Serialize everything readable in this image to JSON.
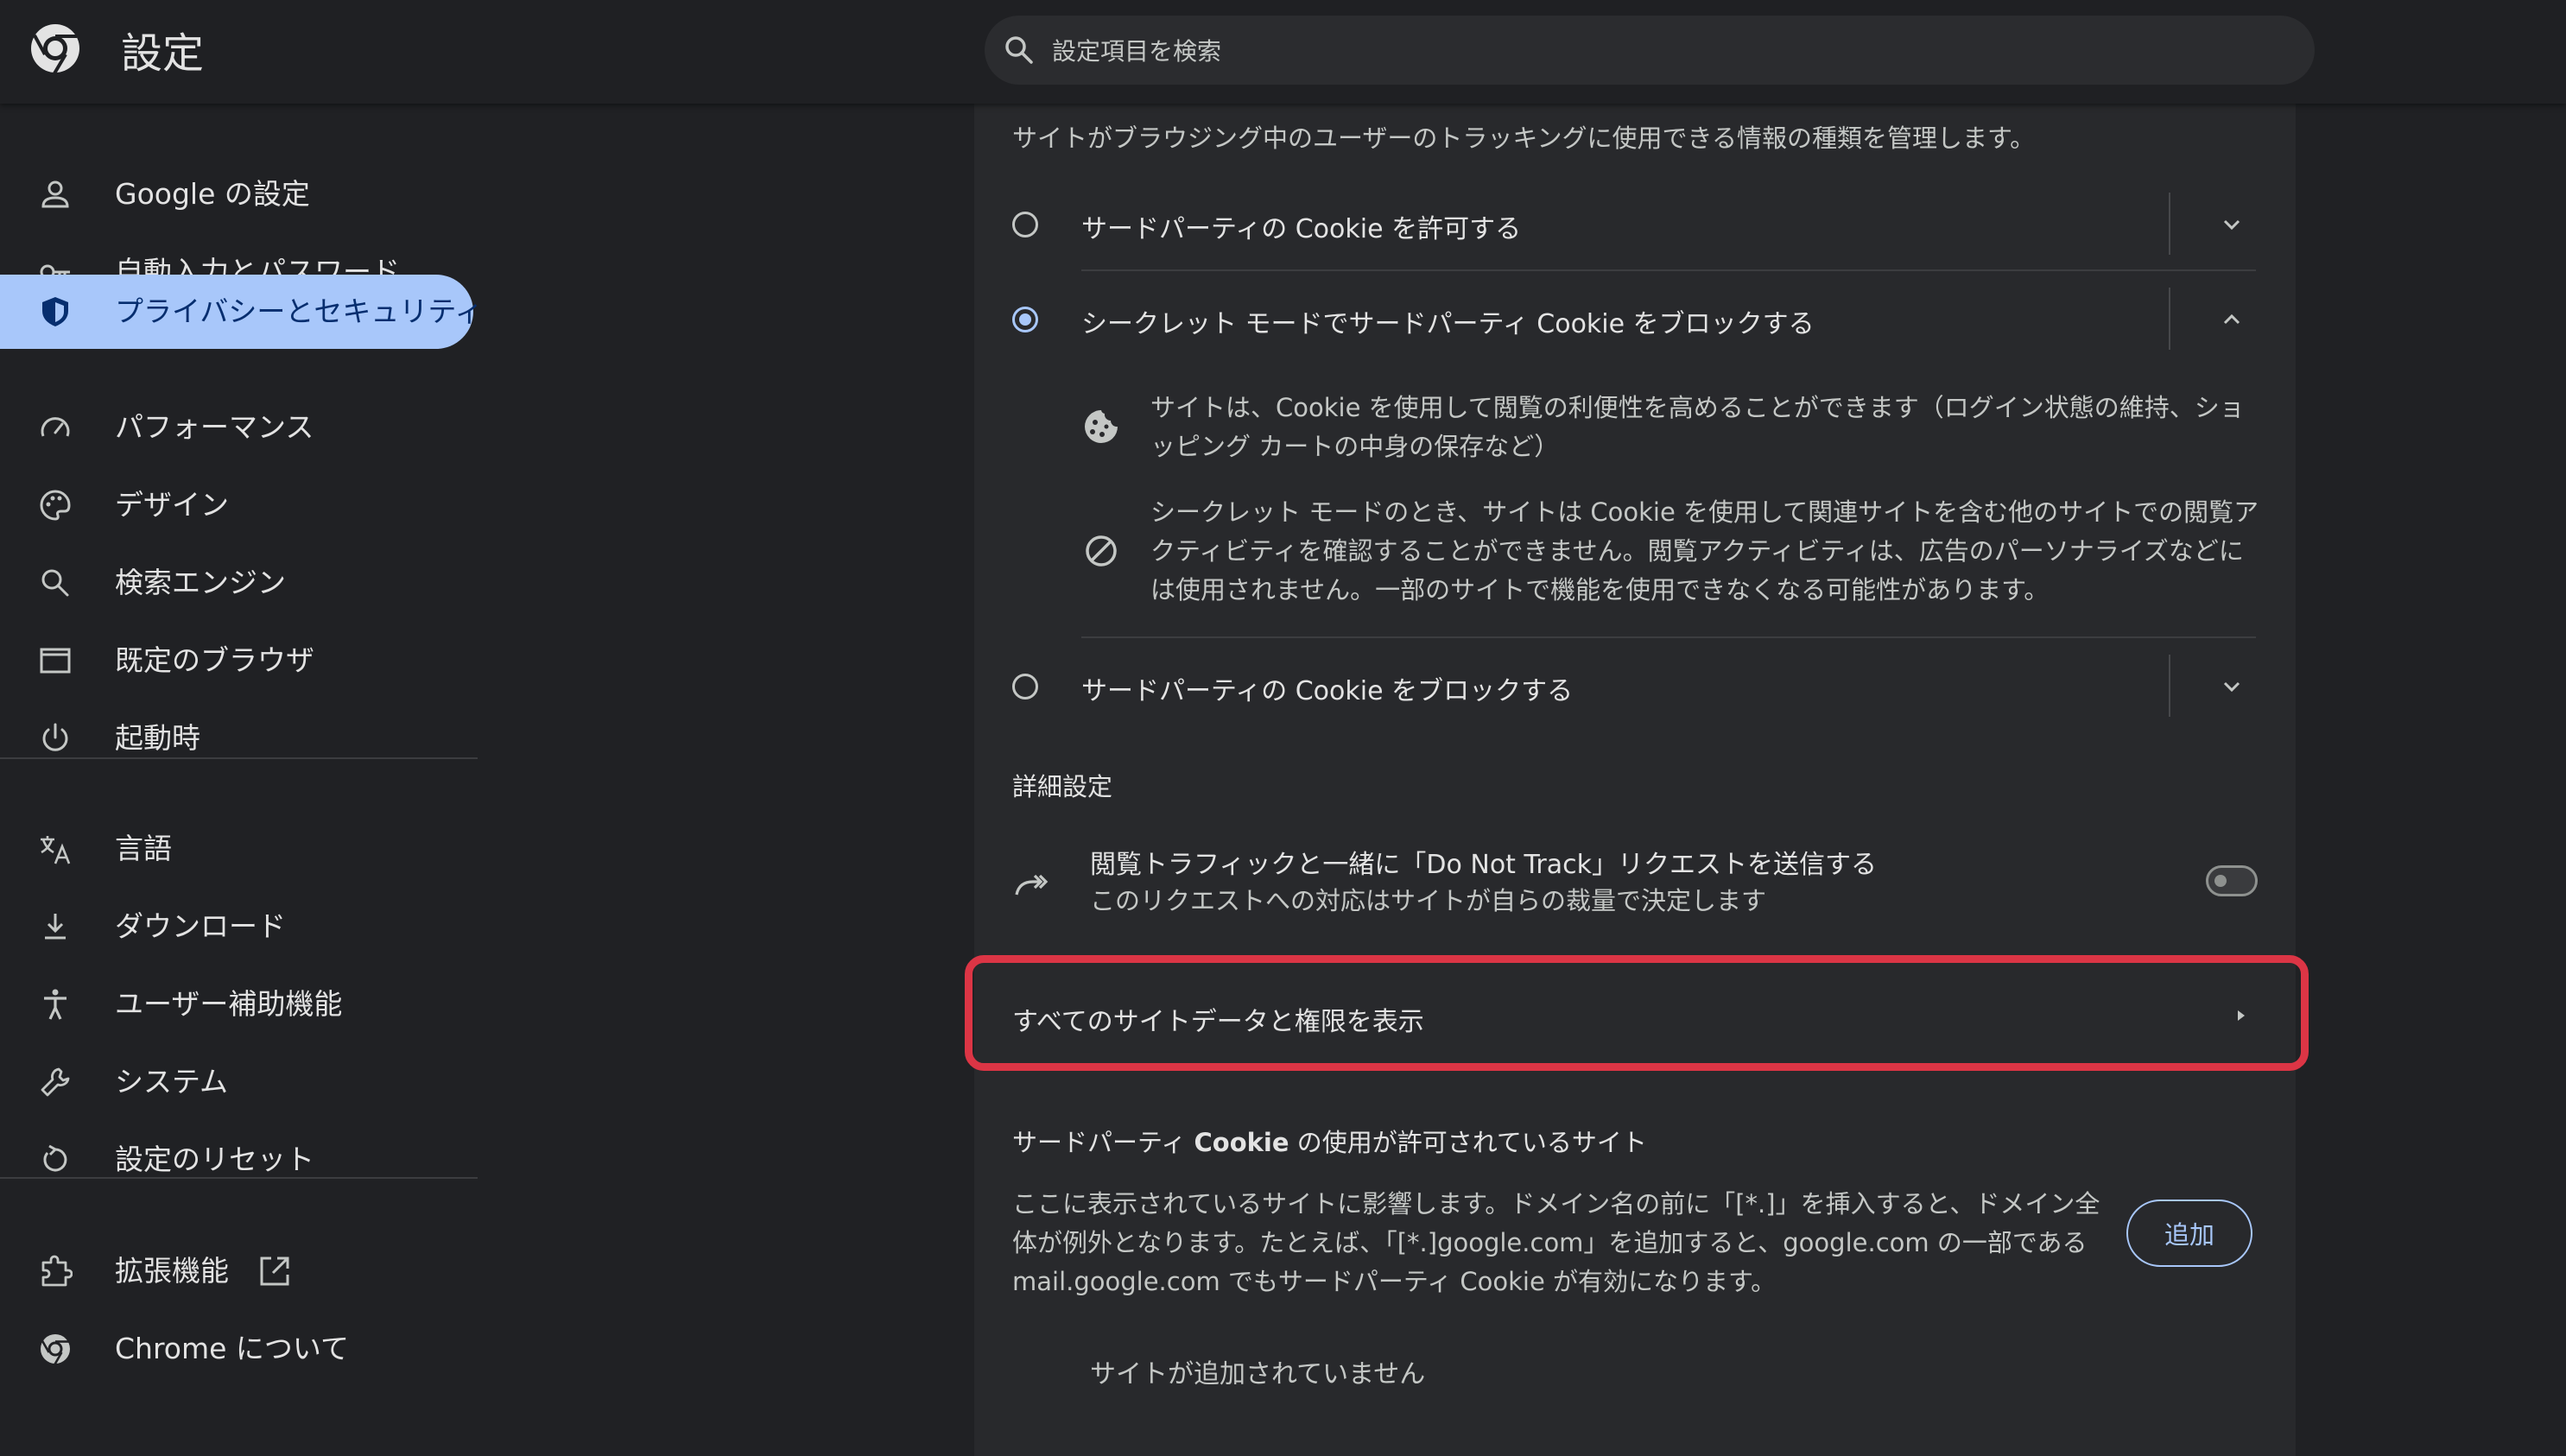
{
  "header": {
    "title": "設定",
    "search_placeholder": "設定項目を検索"
  },
  "sidebar": {
    "items": [
      {
        "label": "Google の設定",
        "icon": "person-icon"
      },
      {
        "label": "自動入力とパスワード",
        "icon": "key-icon"
      },
      {
        "label": "プライバシーとセキュリティ",
        "icon": "shield-icon",
        "active": true
      },
      {
        "label": "パフォーマンス",
        "icon": "speedometer-icon"
      },
      {
        "label": "デザイン",
        "icon": "palette-icon"
      },
      {
        "label": "検索エンジン",
        "icon": "search-icon"
      },
      {
        "label": "既定のブラウザ",
        "icon": "browser-window-icon"
      },
      {
        "label": "起動時",
        "icon": "power-icon"
      },
      {
        "label": "言語",
        "icon": "translate-icon"
      },
      {
        "label": "ダウンロード",
        "icon": "download-icon"
      },
      {
        "label": "ユーザー補助機能",
        "icon": "accessibility-icon"
      },
      {
        "label": "システム",
        "icon": "wrench-icon"
      },
      {
        "label": "設定のリセット",
        "icon": "reset-icon"
      },
      {
        "label": "拡張機能",
        "icon": "puzzle-icon"
      },
      {
        "label": "Chrome について",
        "icon": "chrome-icon"
      }
    ]
  },
  "cookies": {
    "description": "サイトがブラウジング中のユーザーのトラッキングに使用できる情報の種類を管理します。",
    "options": [
      {
        "label": "サードパーティの Cookie を許可する",
        "selected": false,
        "expanded": false
      },
      {
        "label": "シークレット モードでサードパーティ Cookie をブロックする",
        "selected": true,
        "expanded": true
      },
      {
        "label": "サードパーティの Cookie をブロックする",
        "selected": false,
        "expanded": false
      }
    ],
    "details": [
      {
        "icon": "cookie-icon",
        "text": "サイトは、Cookie を使用して閲覧の利便性を高めることができます（ログイン状態の維持、ショッピング カートの中身の保存など）"
      },
      {
        "icon": "block-icon",
        "text": "シークレット モードのとき、サイトは Cookie を使用して関連サイトを含む他のサイトでの閲覧アクティビティを確認することができません。閲覧アクティビティは、広告のパーソナライズなどには使用されません。一部のサイトで機能を使用できなくなる可能性があります。"
      }
    ]
  },
  "advanced": {
    "title": "詳細設定",
    "dnt_title": "閲覧トラフィックと一緒に「Do Not Track」リクエストを送信する",
    "dnt_subtitle": "このリクエストへの対応はサイトが自らの裁量で決定します",
    "dnt_enabled": false
  },
  "site_data": {
    "label": "すべてのサイトデータと権限を表示"
  },
  "allowed_sites": {
    "title_prefix": "サードパーティ ",
    "title_bold": "Cookie",
    "title_suffix": " の使用が許可されているサイト",
    "description": "ここに表示されているサイトに影響します。ドメイン名の前に「[*.]」を挿入すると、ドメイン全体が例外となります。たとえば、「[*.]google.com」を追加すると、google.com の一部である mail.google.com でもサードパーティ Cookie が有効になります。",
    "add_label": "追加",
    "empty_text": "サイトが追加されていません"
  },
  "colors": {
    "background": "#202124",
    "panel": "#28292c",
    "accent": "#a8c7fa",
    "highlight": "#dc3545"
  }
}
